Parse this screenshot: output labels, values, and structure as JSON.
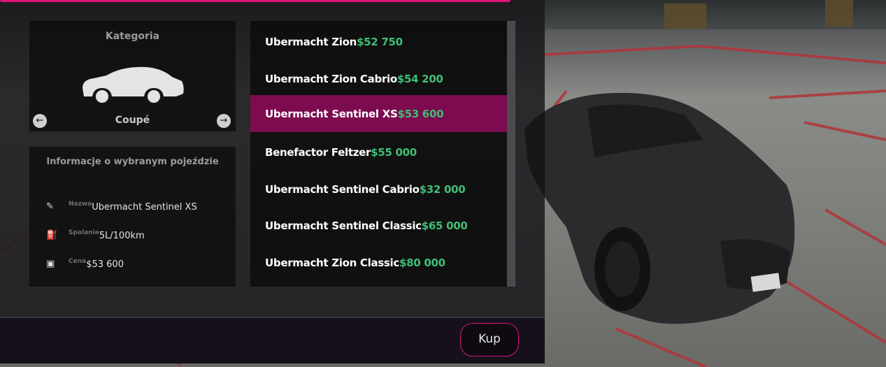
{
  "colors": {
    "accent": "#e0137e",
    "selected_row": "#7d0b4f",
    "price": "#3fbf75"
  },
  "category": {
    "title": "Kategoria",
    "name": "Coupé",
    "prev_icon": "arrow-left-icon",
    "next_icon": "arrow-right-icon"
  },
  "info": {
    "title": "Informacje o wybranym pojeździe",
    "rows": [
      {
        "icon": "edit-icon",
        "label": "Nazwa",
        "value": "Ubermacht Sentinel XS"
      },
      {
        "icon": "fuel-icon",
        "label": "Spalanie",
        "value": "5L/100km"
      },
      {
        "icon": "money-icon",
        "label": "Cena",
        "value": "$53 600"
      }
    ]
  },
  "vehicles": [
    {
      "name": "Ubermacht Zion",
      "price": "$52 750",
      "selected": false
    },
    {
      "name": "Ubermacht Zion Cabrio",
      "price": "$54 200",
      "selected": false
    },
    {
      "name": "Ubermacht Sentinel XS",
      "price": "$53 600",
      "selected": true
    },
    {
      "name": "Benefactor Feltzer",
      "price": "$55 000",
      "selected": false
    },
    {
      "name": "Ubermacht Sentinel Cabrio",
      "price": "$32 000",
      "selected": false
    },
    {
      "name": "Ubermacht Sentinel Classic",
      "price": "$65 000",
      "selected": false
    },
    {
      "name": "Ubermacht Zion Classic",
      "price": "$80 000",
      "selected": false
    }
  ],
  "buy_button": {
    "label": "Kup"
  }
}
